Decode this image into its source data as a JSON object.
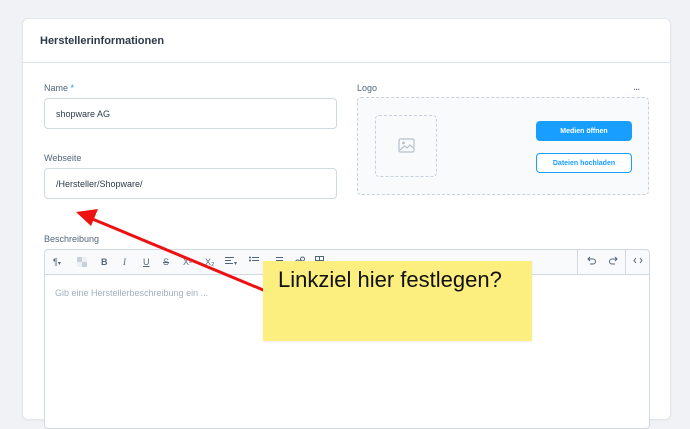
{
  "card": {
    "title": "Herstellerinformationen"
  },
  "form": {
    "name_label": "Name",
    "required_mark": "*",
    "name_value": "shopware AG",
    "website_label": "Webseite",
    "website_value": "/Hersteller/Shopware/",
    "logo_label": "Logo",
    "more_label": "...",
    "description_label": "Beschreibung"
  },
  "logo": {
    "placeholder_icon": "image-icon",
    "open_media_label": "Medien öffnen",
    "upload_label": "Dateien hochladen"
  },
  "editor": {
    "placeholder": "Gib eine Herstellerbeschreibung ein ...",
    "toolbar": {
      "paragraph": "¶",
      "bold": "B",
      "italic": "I",
      "underline": "U",
      "superscript": "X²",
      "subscript": "X₂"
    }
  },
  "annotation": {
    "text": "Linkziel hier festlegen?",
    "note_color": "#fcef7f",
    "arrow_color": "#ee1111"
  },
  "colors": {
    "accent": "#189eff",
    "text": "#2c3a49",
    "muted": "#52667a"
  }
}
